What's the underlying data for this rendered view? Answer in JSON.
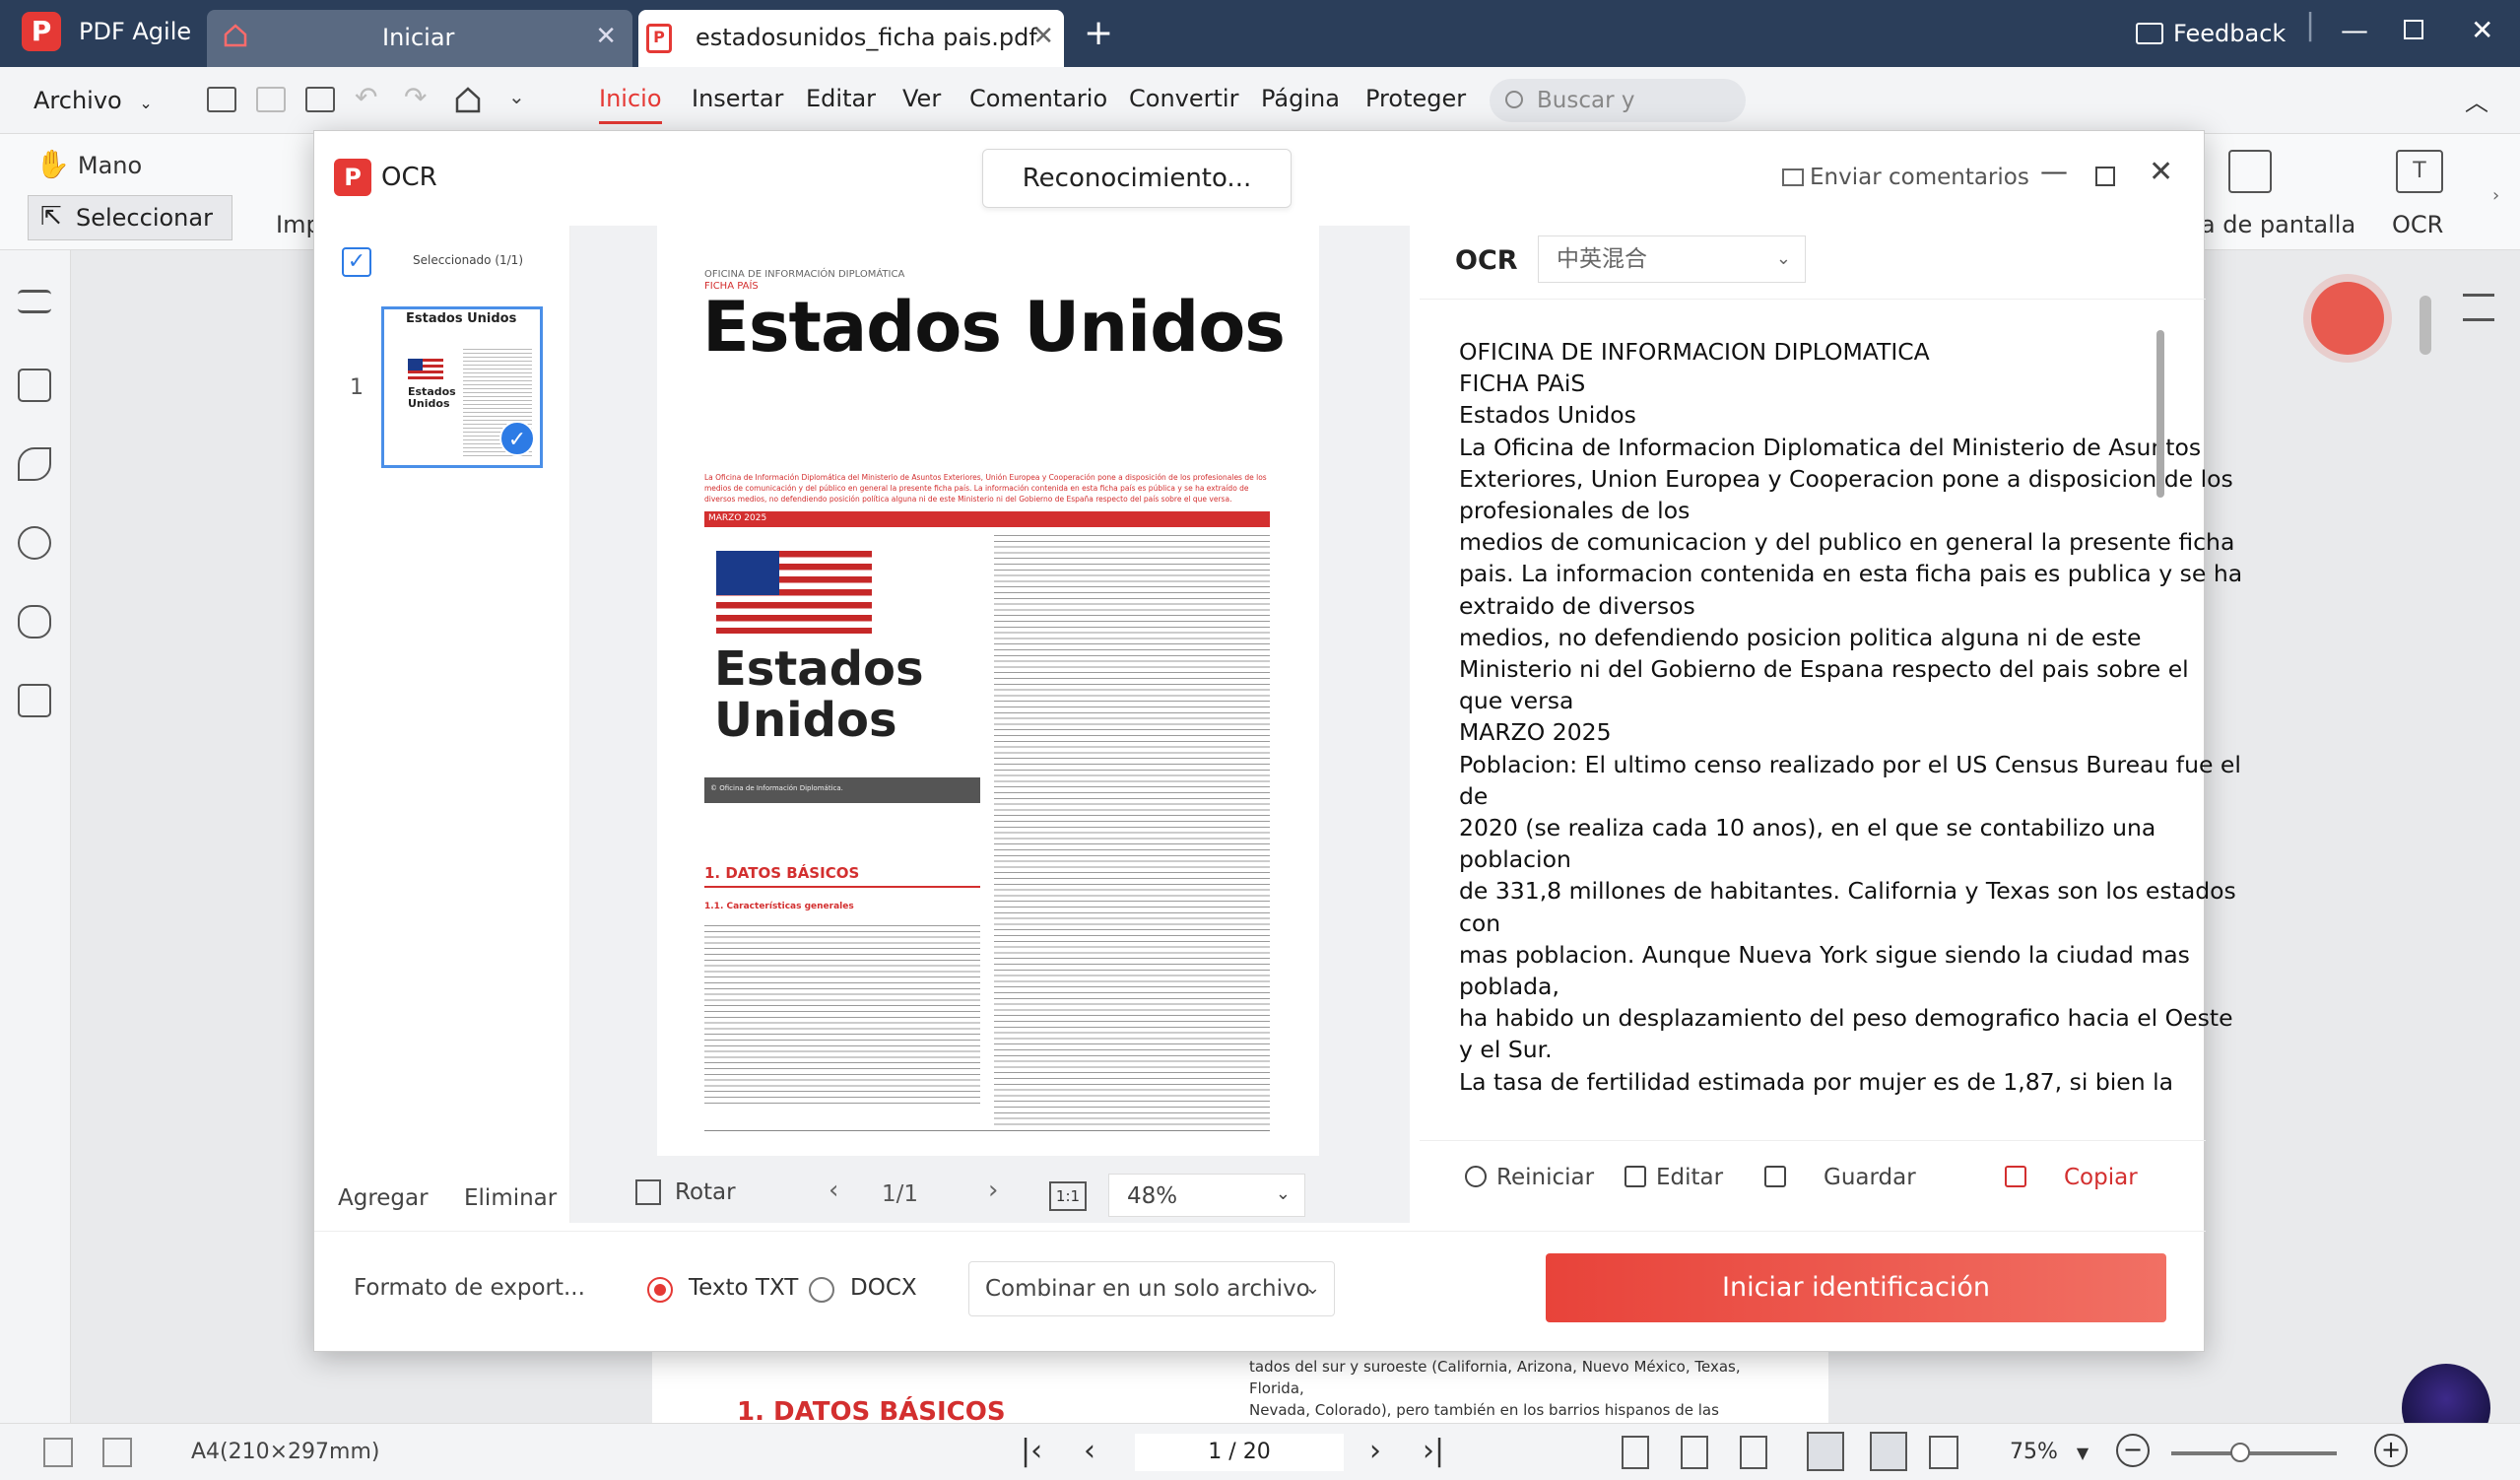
{
  "app": {
    "name": "PDF Agile",
    "logo_letter": "P"
  },
  "tabs": [
    {
      "label": "Iniciar"
    },
    {
      "label": "estadosunidos_ficha pais.pdf"
    }
  ],
  "titlebar": {
    "feedback": "Feedback"
  },
  "menu": {
    "archivo": "Archivo",
    "ribbon_tabs": [
      "Inicio",
      "Insertar",
      "Editar",
      "Ver",
      "Comentario",
      "Convertir",
      "Página",
      "Proteger"
    ],
    "search_placeholder": "Buscar y reempla..."
  },
  "toolbar": {
    "mano": "Mano",
    "seleccionar": "Seleccionar",
    "imp": "Imp",
    "captura": "ra de pantalla",
    "ocr": "OCR"
  },
  "background_doc": {
    "heading": "1. DATOS BÁSICOS",
    "text": "tados del sur y suroeste (California, Arizona, Nuevo México, Texas, Florida,\nNevada, Colorado), pero también en los barrios hispanos de las ciudades de\nNueva York, Los Ángeles, Miami o Washington (D.C.) y municipios cercanos"
  },
  "statusbar": {
    "page_size": "A4(210×297mm)",
    "page_indicator": "1 / 20",
    "zoom": "75%"
  },
  "ocr_modal": {
    "title": "OCR",
    "status": "Reconocimiento...",
    "send_feedback": "Enviar comentarios",
    "thumbnails": {
      "selected_label": "Seleccionado (1/1)",
      "page_number": "1",
      "thumb_title": "Estados Unidos",
      "thumb_big": "Estados Unidos",
      "add": "Agregar",
      "remove": "Eliminar"
    },
    "preview": {
      "office": "OFICINA DE INFORMACIÓN DIPLOMÁTICA",
      "ficha": "FICHA PAÍS",
      "title": "Estados Unidos",
      "intro": "La Oficina de Información Diplomática del Ministerio de Asuntos Exteriores, Unión Europea y Cooperación pone a disposición de los profesionales de los medios de comunicación y del público en general la presente ficha país. La información contenida en esta ficha país es pública y se ha extraído de diversos medios, no defendiendo posición política alguna ni de este Ministerio ni del Gobierno de España respecto del país sobre el que versa.",
      "date": "MARZO 2025",
      "big_title": "Estados Unidos",
      "caption": "© Oficina de Información Diplomática.",
      "section": "1. DATOS BÁSICOS",
      "subsection": "1.1. Características generales",
      "rotate": "Rotar",
      "page": "1/1",
      "actual_size": "1:1",
      "zoom": "48%"
    },
    "result": {
      "label": "OCR",
      "language": "中英混合",
      "lines": [
        "OFICINA DE INFORMACION DIPLOMATICA",
        "FICHA PAiS",
        "Estados Unidos",
        "La Oficina de Informacion Diplomatica del Ministerio de Asuntos",
        "Exteriores, Union Europea y Cooperacion pone a disposicion de los",
        "profesionales de los",
        "medios de comunicacion y del publico en general la presente ficha",
        "pais. La informacion contenida en esta ficha pais es publica y se ha",
        "extraido de diversos",
        "medios, no defendiendo posicion politica alguna ni de este",
        "Ministerio ni del Gobierno de Espana respecto del pais sobre el",
        "que versa",
        "MARZO 2025",
        "Poblacion: El ultimo censo realizado por el US Census Bureau fue el",
        "de",
        "2020 (se realiza cada 10 anos), en el que se contabilizo una",
        "poblacion",
        "de 331,8 millones de habitantes. California y Texas son los estados",
        "con",
        "mas poblacion. Aunque Nueva York sigue siendo la ciudad mas",
        "poblada,",
        "ha habido un desplazamiento del peso demografico hacia el Oeste",
        "y el Sur.",
        "La tasa de fertilidad estimada por mujer es de 1,87, si bien la"
      ],
      "actions": {
        "reset": "Reiniciar",
        "edit": "Editar",
        "save": "Guardar",
        "copy": "Copiar"
      }
    },
    "export": {
      "format_label": "Formato de export...",
      "txt": "Texto TXT",
      "docx": "DOCX",
      "merge": "Combinar en un solo archivo",
      "start": "Iniciar identificación"
    }
  }
}
